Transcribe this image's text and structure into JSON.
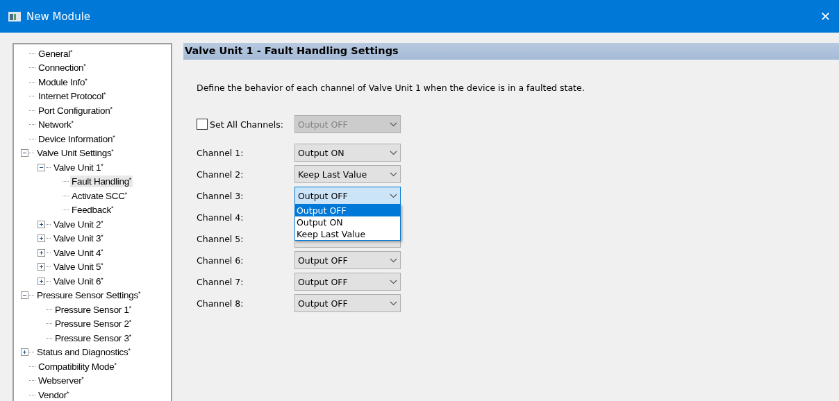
{
  "window": {
    "title": "New Module",
    "close": "✕"
  },
  "tree": [
    {
      "label": "General$^{*}$",
      "selected": false
    },
    {
      "label": "Connection$^{*}$",
      "selected": false
    },
    {
      "label": "Module Info$^{*}$",
      "selected": false
    },
    {
      "label": "Internet Protocol$^{*}$",
      "selected": false
    },
    {
      "label": "Port Configuration$^{*}$",
      "selected": false
    },
    {
      "label": "Network$^{*}$",
      "selected": false
    },
    {
      "label": "Device Information$^{*}$",
      "selected": false
    },
    {
      "label": "Valve Unit Settings$^{*}$",
      "selected": false,
      "expanded": true,
      "children": [
        {
          "label": "Valve Unit 1$^{*}$",
          "selected": false,
          "expanded": true,
          "children": [
            {
              "label": "Fault Handling$^{*}$",
              "selected": true
            },
            {
              "label": "Activate SCC$^{*}$",
              "selected": false
            },
            {
              "label": "Feedback$^{*}$",
              "selected": false
            }
          ]
        },
        {
          "label": "Valve Unit 2$^{*}$",
          "selected": false,
          "expanded": false
        },
        {
          "label": "Valve Unit 3$^{*}$",
          "selected": false,
          "expanded": false
        },
        {
          "label": "Valve Unit 4$^{*}$",
          "selected": false,
          "expanded": false
        },
        {
          "label": "Valve Unit 5$^{*}$",
          "selected": false,
          "expanded": false
        },
        {
          "label": "Valve Unit 6$^{*}$",
          "selected": false,
          "expanded": false
        }
      ]
    },
    {
      "label": "Pressure Sensor Settings$^{*}$",
      "selected": false,
      "expanded": true,
      "children": [
        {
          "label": "Pressure Sensor 1$^{*}$",
          "selected": false
        },
        {
          "label": "Pressure Sensor 2$^{*}$",
          "selected": false
        },
        {
          "label": "Pressure Sensor 3$^{*}$",
          "selected": false
        }
      ]
    },
    {
      "label": "Status and Diagnostics$^{*}$",
      "selected": false,
      "expanded": false
    },
    {
      "label": "Compatibility Mode$^{*}$",
      "selected": false
    },
    {
      "label": "Webserver$^{*}$",
      "selected": false
    },
    {
      "label": "Vendor$^{*}$",
      "selected": false
    }
  ],
  "heading": "Valve Unit 1 - Fault Handling Settings",
  "description": "Define the behavior of each channel of Valve Unit 1 when the device is in a faulted state.",
  "set_all": {
    "label": "Set All Channels:",
    "checked": false,
    "value": "Output OFF",
    "disabled": true
  },
  "channels": [
    {
      "label": "Channel 1:",
      "value": "Output ON",
      "focused": false,
      "open": false
    },
    {
      "label": "Channel 2:",
      "value": "Keep Last Value",
      "focused": false,
      "open": false
    },
    {
      "label": "Channel 3:",
      "value": "Output OFF",
      "focused": true,
      "open": true
    },
    {
      "label": "Channel 4:",
      "open": false
    },
    {
      "label": "Channel 5:",
      "open": false
    },
    {
      "label": "Channel 6:",
      "value": "Output OFF",
      "focused": false,
      "open": false
    },
    {
      "label": "Channel 7:",
      "value": "Output OFF",
      "focused": false,
      "open": false
    },
    {
      "label": "Channel 8:",
      "value": "Output OFF",
      "focused": false,
      "open": false
    }
  ],
  "dropdown_options": [
    {
      "label": "Output OFF",
      "selected": true
    },
    {
      "label": "Output ON",
      "selected": false
    },
    {
      "label": "Keep Last Value",
      "selected": false
    }
  ]
}
